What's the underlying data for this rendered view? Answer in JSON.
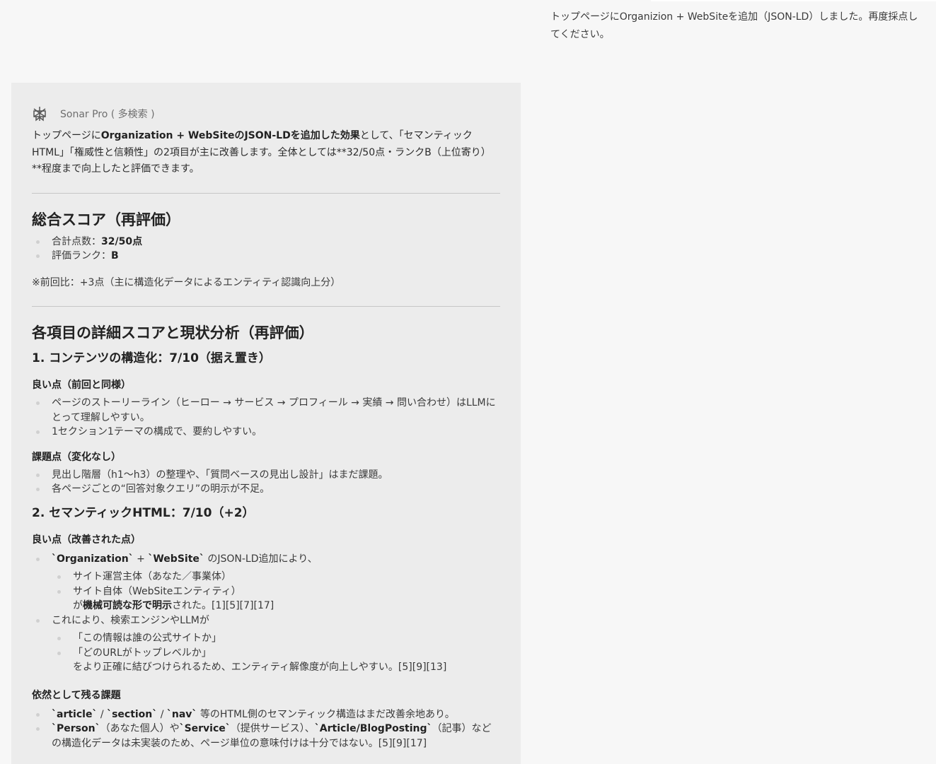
{
  "user_message": "トップページにOrganizion + WebSiteを追加（JSON-LD）しました。再度採点してください。",
  "model": {
    "name": "Sonar Pro ( 多検索 )",
    "icon": "perplexity-icon"
  },
  "intro": {
    "part1": "トップページに",
    "bold1": "Organization + WebSiteのJSON-LDを追加した効果",
    "part2": "として、「セマンティックHTML」「権威性と信頼性」の2項目が主に改善します。全体としては**32/50点・ランクB（上位寄り）**程度まで向上したと評価できます。"
  },
  "total": {
    "heading": "総合スコア（再評価）",
    "score_label": "合計点数：",
    "score_value": "32/50点",
    "rank_label": "評価ランク：",
    "rank_value": "B",
    "note": "※前回比：+3点（主に構造化データによるエンティティ認識向上分）"
  },
  "detail_heading": "各項目の詳細スコアと現状分析（再評価）",
  "s1": {
    "heading": "1. コンテンツの構造化：7/10（据え置き）",
    "good_heading": "良い点（前回と同様）",
    "good": [
      "ページのストーリーライン（ヒーロー → サービス → プロフィール → 実績 → 問い合わせ）はLLMにとって理解しやすい。",
      "1セクション1テーマの構成で、要約しやすい。"
    ],
    "issue_heading": "課題点（変化なし）",
    "issues": [
      "見出し階層（h1〜h3）の整理や、「質問ベースの見出し設計」はまだ課題。",
      "各ページごとの“回答対象クエリ”の明示が不足。"
    ]
  },
  "s2": {
    "heading": "2. セマンティックHTML：7/10（+2）",
    "good_heading": "良い点（改善された点）",
    "g1_code1": "`Organization`",
    "g1_plus": " + ",
    "g1_code2": "`WebSite`",
    "g1_text": " のJSON-LD追加により、",
    "g1_sub": [
      "サイト運営主体（あなた／事業体）",
      "サイト自体（WebSiteエンティティ）"
    ],
    "g1_cont_pre": "が",
    "g1_cont_bold": "機械可読な形で明示",
    "g1_cont_post": "された。[1][5][7][17]",
    "g2_text": "これにより、検索エンジンやLLMが",
    "g2_sub": [
      "「この情報は誰の公式サイトか」",
      "「どのURLがトップレベルか」"
    ],
    "g2_cont": "をより正確に結びつけられるため、エンティティ解像度が向上しやすい。[5][9][13]",
    "remain_heading": "依然として残る課題",
    "r1_c1": "`article`",
    "r1_sep1": " / ",
    "r1_c2": "`section`",
    "r1_sep2": " / ",
    "r1_c3": "`nav`",
    "r1_text": " 等のHTML側のセマンティック構造はまだ改善余地あり。",
    "r2_c1": "`Person`",
    "r2_t1": "（あなた個人）や",
    "r2_c2": "`Service`",
    "r2_t2": "（提供サービス）、",
    "r2_c3": "`Article/BlogPosting`",
    "r2_t3": "（記事）などの構造化データは未実装のため、ページ単位の意味付けは十分ではない。[5][9][17]"
  }
}
